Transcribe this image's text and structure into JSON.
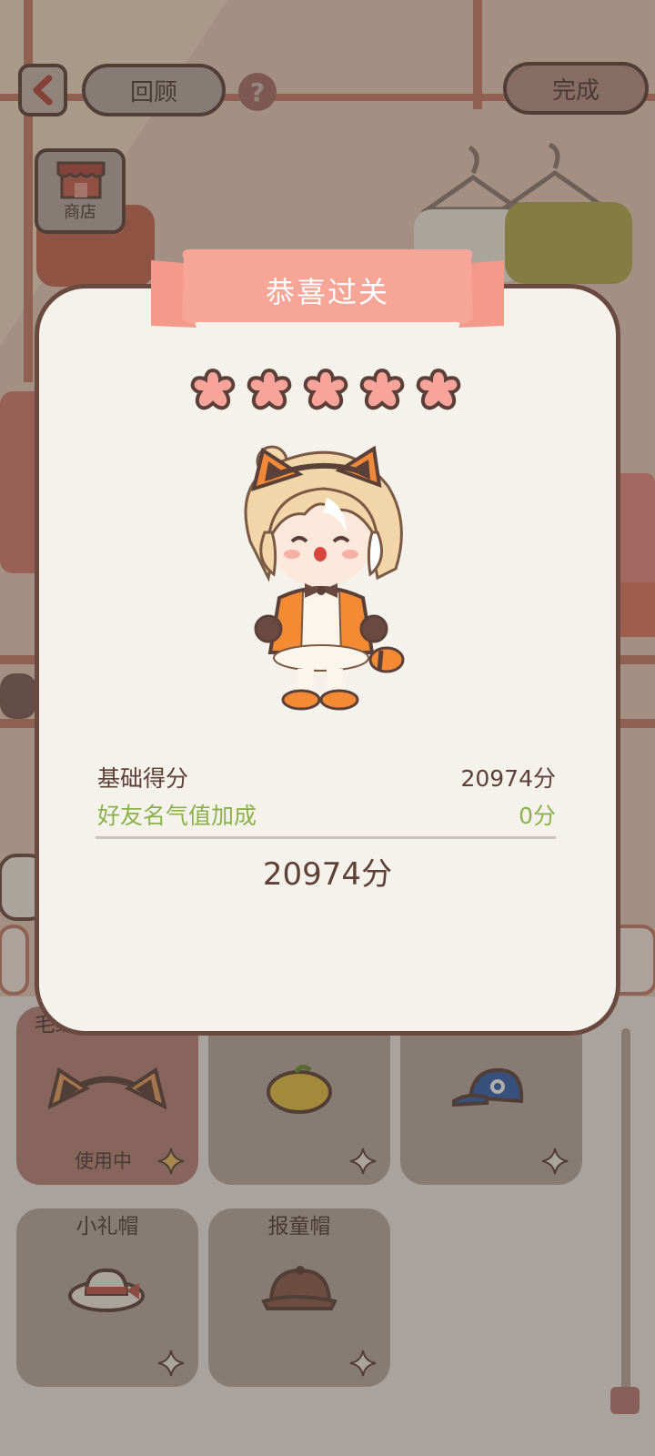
{
  "top_bar": {
    "review_label": "回顾",
    "done_label": "完成",
    "help_glyph": "?",
    "shop_label": "商店"
  },
  "modal": {
    "title": "恭喜过关",
    "stars_filled": 5,
    "stars_total": 5,
    "base_score_label": "基础得分",
    "base_score_value": "20974分",
    "bonus_label": "好友名气值加成",
    "bonus_value": "0分",
    "total_value": "20974分"
  },
  "items": [
    {
      "name": "毛绒小浣熊发箍",
      "status": "使用中",
      "icon": "raccoon-ear-headband-icon",
      "active": true
    },
    {
      "name": "柠檬贝雷帽",
      "status": "",
      "icon": "lemon-beret-icon",
      "active": false
    },
    {
      "name": "蓝色棒球帽",
      "status": "",
      "icon": "blue-baseball-cap-icon",
      "active": false
    },
    {
      "name": "小礼帽",
      "status": "",
      "icon": "small-top-hat-icon",
      "active": false
    },
    {
      "name": "报童帽",
      "status": "",
      "icon": "newsboy-cap-icon",
      "active": false
    }
  ],
  "colors": {
    "accent_pink": "#f7a596",
    "bonus_green": "#8bb14a",
    "text_brown": "#5d4037",
    "modal_bg": "#f5f2ec"
  }
}
